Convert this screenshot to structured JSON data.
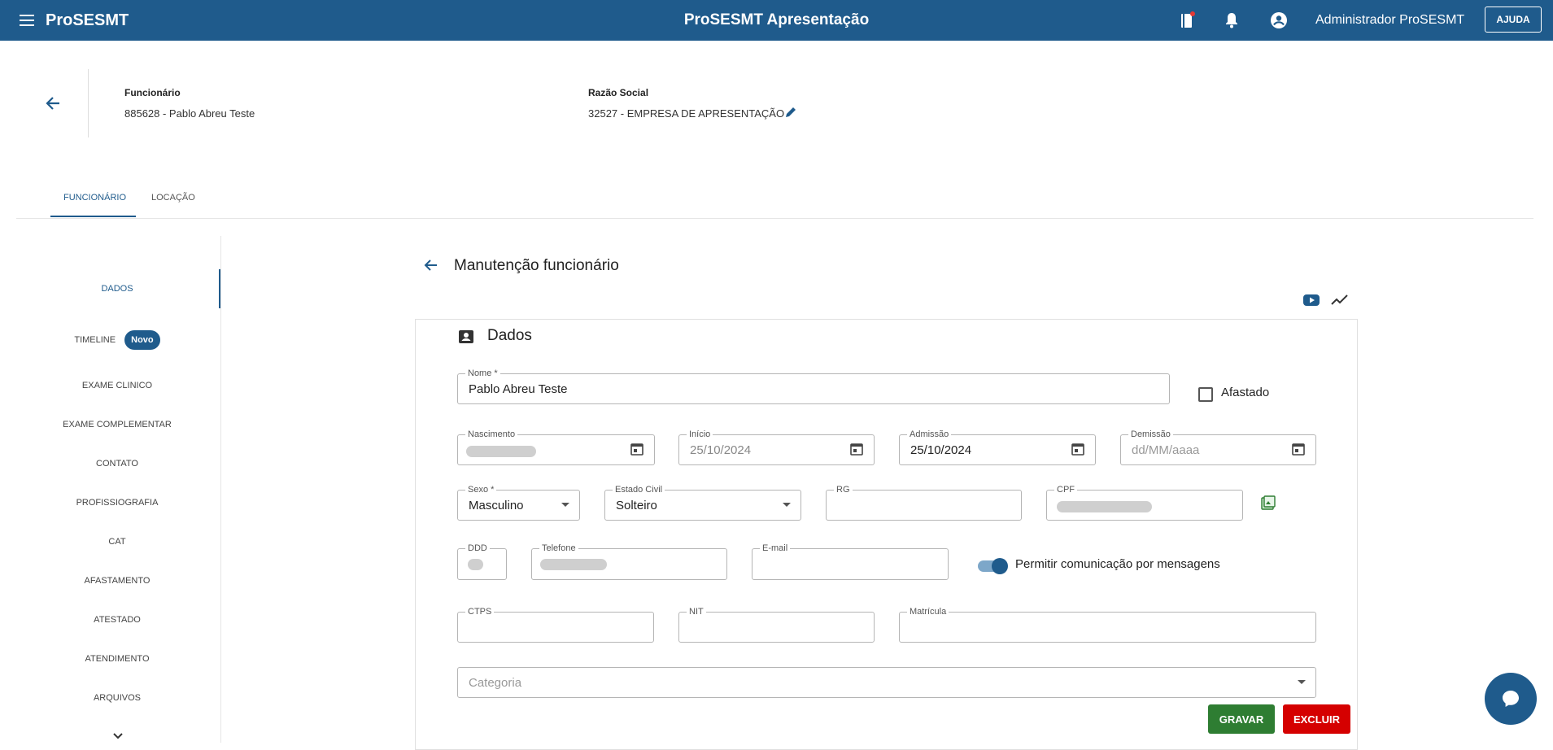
{
  "topbar": {
    "app_name": "ProSESMT",
    "center_title": "ProSESMT Apresentação",
    "user_name": "Administrador ProSESMT",
    "help_label": "AJUDA"
  },
  "header": {
    "employee_label": "Funcionário",
    "employee_value": "885628 - Pablo Abreu Teste",
    "company_label": "Razão Social",
    "company_value": "32527 - EMPRESA DE APRESENTAÇÃO"
  },
  "tabs": [
    {
      "label": "FUNCIONÁRIO",
      "active": true
    },
    {
      "label": "LOCAÇÃO",
      "active": false
    }
  ],
  "sidebar": {
    "items": [
      {
        "label": "DADOS",
        "active": true
      },
      {
        "label": "TIMELINE",
        "badge": "Novo"
      },
      {
        "label": "EXAME CLINICO"
      },
      {
        "label": "EXAME COMPLEMENTAR"
      },
      {
        "label": "CONTATO"
      },
      {
        "label": "PROFISSIOGRAFIA"
      },
      {
        "label": "CAT"
      },
      {
        "label": "AFASTAMENTO"
      },
      {
        "label": "ATESTADO"
      },
      {
        "label": "ATENDIMENTO"
      },
      {
        "label": "ARQUIVOS"
      }
    ]
  },
  "main": {
    "title": "Manutenção funcionário",
    "section_title": "Dados"
  },
  "form": {
    "nome": {
      "label": "Nome *",
      "value": "Pablo Abreu Teste"
    },
    "afastado_label": "Afastado",
    "nascimento": {
      "label": "Nascimento"
    },
    "inicio": {
      "label": "Início",
      "value": "25/10/2024"
    },
    "admissao": {
      "label": "Admissão",
      "value": "25/10/2024"
    },
    "demissao": {
      "label": "Demissão",
      "placeholder": "dd/MM/aaaa"
    },
    "sexo": {
      "label": "Sexo *",
      "value": "Masculino"
    },
    "estado_civil": {
      "label": "Estado Civil",
      "value": "Solteiro"
    },
    "rg": {
      "label": "RG",
      "value": ""
    },
    "cpf": {
      "label": "CPF"
    },
    "ddd": {
      "label": "DDD"
    },
    "telefone": {
      "label": "Telefone"
    },
    "email": {
      "label": "E-mail",
      "value": ""
    },
    "permitir_label": "Permitir comunicação por mensagens",
    "ctps": {
      "label": "CTPS",
      "value": ""
    },
    "nit": {
      "label": "NIT",
      "value": ""
    },
    "matricula": {
      "label": "Matrícula",
      "value": ""
    },
    "categoria": {
      "placeholder": "Categoria"
    }
  },
  "actions": {
    "save_label": "GRAVAR",
    "delete_label": "EXCLUIR"
  },
  "colors": {
    "primary": "#1f5b8c",
    "save": "#2e7d32",
    "delete": "#d50000"
  }
}
